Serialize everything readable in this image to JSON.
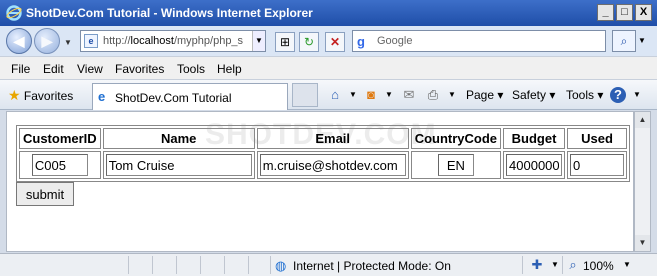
{
  "window": {
    "title": "ShotDev.Com Tutorial - Windows Internet Explorer",
    "buttons": {
      "minimize": "_",
      "maximize": "□",
      "close": "X"
    }
  },
  "address_bar": {
    "url_prefix": "http://",
    "url_host": "localhost",
    "url_path": "/myphp/php_sq",
    "search_placeholder": "Google",
    "search_engine_icon": "google-icon"
  },
  "menu": [
    "File",
    "Edit",
    "View",
    "Favorites",
    "Tools",
    "Help"
  ],
  "command_bar": {
    "favorites_label": "Favorites",
    "tab_title": "ShotDev.Com Tutorial",
    "page_label": "Page",
    "safety_label": "Safety",
    "tools_label": "Tools"
  },
  "page": {
    "watermark": "SHOTDEV.COM",
    "table": {
      "headers": [
        "CustomerID",
        "Name",
        "Email",
        "CountryCode",
        "Budget",
        "Used"
      ],
      "values": {
        "customer_id": "C005",
        "name": "Tom Cruise",
        "email": "m.cruise@shotdev.com",
        "country_code": "EN",
        "budget": "4000000",
        "used": "0"
      }
    },
    "submit_label": "submit"
  },
  "status_bar": {
    "zone_text": "Internet | Protected Mode: On",
    "zoom": "100%"
  }
}
